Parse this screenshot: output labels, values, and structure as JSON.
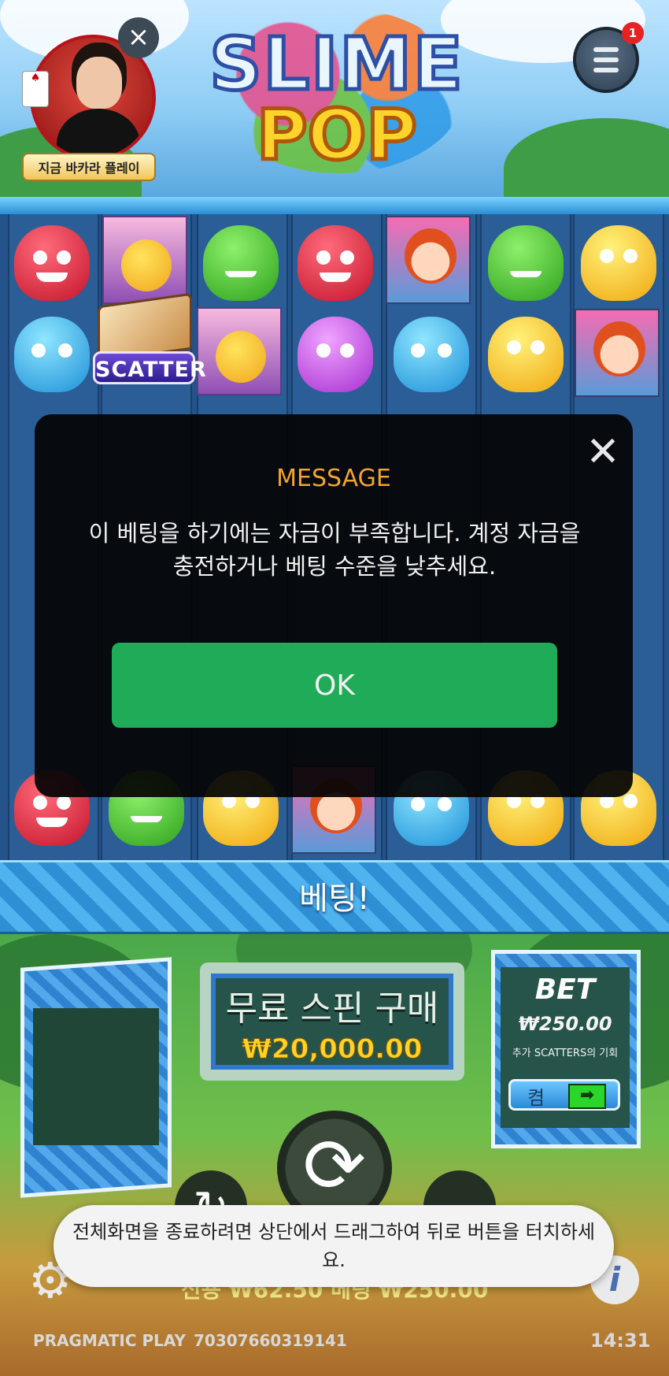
{
  "header": {
    "logo_line1": "SLIME",
    "logo_line2": "POP",
    "promo_label": "지금 바카라 플레이",
    "promo_close_icon": "close-icon",
    "menu_icon": "hamburger-menu-icon",
    "menu_badge": "1"
  },
  "grid": {
    "scatter_label": "SCATTER"
  },
  "banner": {
    "text": "베팅!"
  },
  "buy_feature": {
    "title": "무료 스핀 구매",
    "price": "₩20,000.00"
  },
  "bet_panel": {
    "title": "BET",
    "amount": "₩250.00",
    "note": "추가 SCATTERS의 기회",
    "toggle_label": "켬",
    "toggle_arrow": "➡"
  },
  "controls": {
    "spin_icon": "⟳",
    "autoplay_icon": "↻",
    "settings_icon": "⚙",
    "info_icon": "i",
    "credit_row": "신용 ₩62.50   베팅 ₩250.00"
  },
  "footer": {
    "provider": "PRAGMATIC PLAY",
    "session_id": "70307660319141",
    "time": "14:31"
  },
  "dialog": {
    "close_icon": "✕",
    "title": "MESSAGE",
    "body": "이 베팅을 하기에는 자금이 부족합니다. 계정 자금을 충전하거나 베팅 수준을 낮추세요.",
    "ok_label": "OK"
  },
  "toast": {
    "text": "전체화면을 종료하려면 상단에서 드래그하여 뒤로 버튼을 터치하세요."
  },
  "colors": {
    "dialog_title": "#f0a430",
    "ok_button": "#1fab58",
    "bet_amount": "#f4f4f4",
    "buy_price": "#ffd326"
  }
}
